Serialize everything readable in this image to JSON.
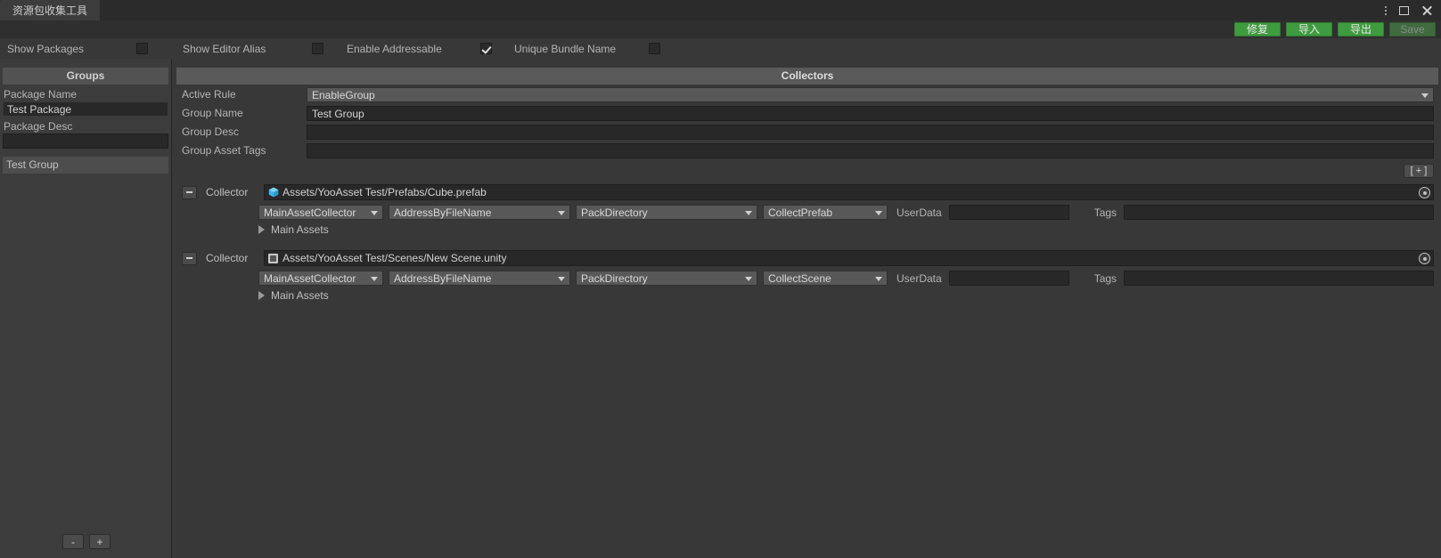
{
  "window": {
    "tab_title": "资源包收集工具",
    "menu_icon": "kebab-menu-icon",
    "maximize_icon": "maximize-icon",
    "close_icon": "close-icon"
  },
  "toolbar": {
    "buttons": [
      {
        "label": "修复",
        "enabled": true
      },
      {
        "label": "导入",
        "enabled": true
      },
      {
        "label": "导出",
        "enabled": true
      },
      {
        "label": "Save",
        "enabled": false
      }
    ],
    "accent_green": "#3f9b3f",
    "disabled_green": "#3f6b3f"
  },
  "options": [
    {
      "label": "Show Packages",
      "checked": false
    },
    {
      "label": "Show Editor Alias",
      "checked": false
    },
    {
      "label": "Enable Addressable",
      "checked": true
    },
    {
      "label": "Unique Bundle Name",
      "checked": false
    }
  ],
  "sidebar": {
    "header": "Groups",
    "package_name_label": "Package Name",
    "package_name_value": "Test Package",
    "package_desc_label": "Package Desc",
    "package_desc_value": "",
    "groups": [
      {
        "label": "Test Group",
        "selected": true
      }
    ],
    "remove_button": "-",
    "add_button": "+"
  },
  "main": {
    "header": "Collectors",
    "fields": [
      {
        "label": "Active Rule",
        "type": "dropdown",
        "value": "EnableGroup"
      },
      {
        "label": "Group Name",
        "type": "text",
        "value": "Test Group"
      },
      {
        "label": "Group Desc",
        "type": "text",
        "value": ""
      },
      {
        "label": "Group Asset Tags",
        "type": "text",
        "value": ""
      }
    ],
    "add_collector_label": "[ + ]",
    "collectors": [
      {
        "word": "Collector",
        "asset_path": "Assets/YooAsset Test/Prefabs/Cube.prefab",
        "asset_icon": "prefab-icon",
        "collector_type": "MainAssetCollector",
        "address_rule": "AddressByFileName",
        "pack_rule": "PackDirectory",
        "filter_rule": "CollectPrefab",
        "userdata_label": "UserData",
        "userdata_value": "",
        "tags_label": "Tags",
        "tags_value": "",
        "foldout_label": "Main Assets",
        "foldout_expanded": false
      },
      {
        "word": "Collector",
        "asset_path": "Assets/YooAsset Test/Scenes/New Scene.unity",
        "asset_icon": "scene-icon",
        "collector_type": "MainAssetCollector",
        "address_rule": "AddressByFileName",
        "pack_rule": "PackDirectory",
        "filter_rule": "CollectScene",
        "userdata_label": "UserData",
        "userdata_value": "",
        "tags_label": "Tags",
        "tags_value": "",
        "foldout_label": "Main Assets",
        "foldout_expanded": false
      }
    ]
  }
}
